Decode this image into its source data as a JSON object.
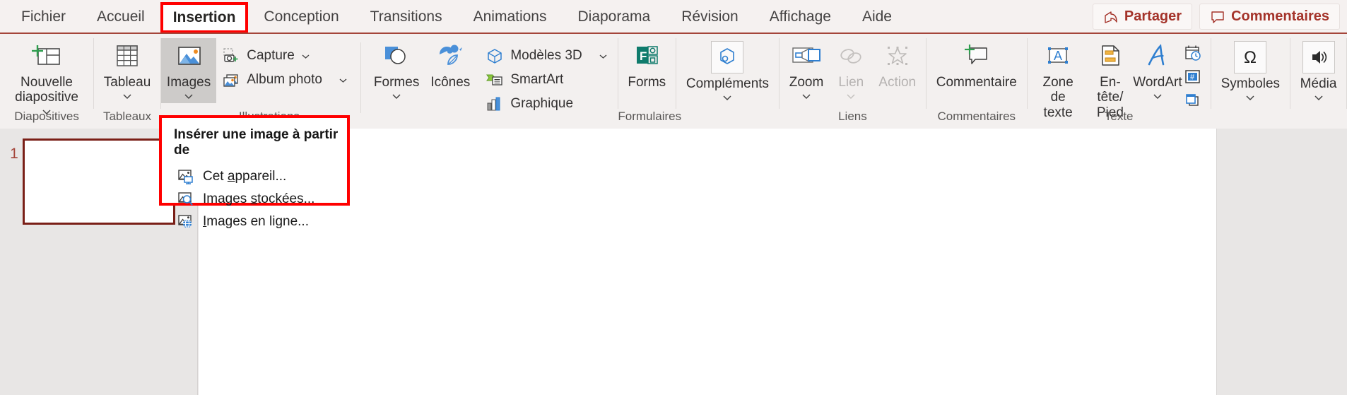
{
  "app": {
    "name": "PowerPoint",
    "language": "fr"
  },
  "tabbar": {
    "tabs": [
      {
        "id": "fichier",
        "label": "Fichier",
        "active": false
      },
      {
        "id": "accueil",
        "label": "Accueil",
        "active": false
      },
      {
        "id": "insertion",
        "label": "Insertion",
        "active": true
      },
      {
        "id": "conception",
        "label": "Conception",
        "active": false
      },
      {
        "id": "transitions",
        "label": "Transitions",
        "active": false
      },
      {
        "id": "animations",
        "label": "Animations",
        "active": false
      },
      {
        "id": "diaporama",
        "label": "Diaporama",
        "active": false
      },
      {
        "id": "revision",
        "label": "Révision",
        "active": false
      },
      {
        "id": "affichage",
        "label": "Affichage",
        "active": false
      },
      {
        "id": "aide",
        "label": "Aide",
        "active": false
      }
    ],
    "share_label": "Partager",
    "comments_label": "Commentaires",
    "accent_color": "#a4332a",
    "highlight_color": "#ff0000"
  },
  "ribbon": {
    "groups": [
      {
        "id": "diapositives",
        "label": "Diapositives",
        "buttons": [
          {
            "id": "nouvelle-diapositive",
            "label": "Nouvelle\ndiapositive",
            "icon": "new-slide-icon",
            "has_chevron": true
          }
        ]
      },
      {
        "id": "tableaux",
        "label": "Tableaux",
        "buttons": [
          {
            "id": "tableau",
            "label": "Tableau",
            "icon": "table-icon",
            "has_chevron": true
          }
        ]
      },
      {
        "id": "illustrations",
        "label": "Illustrations",
        "buttons": [
          {
            "id": "images",
            "label": "Images",
            "icon": "pictures-icon",
            "has_chevron": true,
            "selected": true
          },
          {
            "id": "formes",
            "label": "Formes",
            "icon": "shapes-icon",
            "has_chevron": true
          },
          {
            "id": "icones",
            "label": "Icônes",
            "icon": "icons-icon",
            "has_chevron": false
          }
        ],
        "small_buttons_1": [
          {
            "id": "capture",
            "label": "Capture",
            "icon": "screenshot-icon",
            "has_chevron": true
          },
          {
            "id": "album-photo",
            "label": "Album photo",
            "icon": "photo-album-icon",
            "has_chevron": true
          }
        ],
        "small_buttons_2": [
          {
            "id": "modeles-3d",
            "label": "Modèles 3D",
            "icon": "3d-model-icon",
            "has_chevron": true
          },
          {
            "id": "smartart",
            "label": "SmartArt",
            "icon": "smartart-icon",
            "has_chevron": false
          },
          {
            "id": "graphique",
            "label": "Graphique",
            "icon": "chart-icon",
            "has_chevron": false
          }
        ]
      },
      {
        "id": "formulaires",
        "label": "Formulaires",
        "buttons": [
          {
            "id": "forms",
            "label": "Forms",
            "icon": "forms-icon",
            "has_chevron": false
          }
        ]
      },
      {
        "id": "complements-group",
        "label": "",
        "buttons": [
          {
            "id": "complements",
            "label": "Compléments",
            "icon": "addins-icon",
            "has_chevron": true,
            "boxed": true
          }
        ]
      },
      {
        "id": "liens",
        "label": "Liens",
        "buttons": [
          {
            "id": "zoom",
            "label": "Zoom",
            "icon": "zoom-icon",
            "has_chevron": true
          },
          {
            "id": "lien",
            "label": "Lien",
            "icon": "link-icon",
            "has_chevron": true,
            "disabled": true
          },
          {
            "id": "action",
            "label": "Action",
            "icon": "action-icon",
            "has_chevron": false,
            "disabled": true
          }
        ]
      },
      {
        "id": "commentaires",
        "label": "Commentaires",
        "buttons": [
          {
            "id": "commentaire",
            "label": "Commentaire",
            "icon": "new-comment-icon",
            "has_chevron": false
          }
        ]
      },
      {
        "id": "texte",
        "label": "Texte",
        "buttons": [
          {
            "id": "zone-de-texte",
            "label": "Zone\nde texte",
            "icon": "text-box-icon",
            "has_chevron": false
          },
          {
            "id": "en-tete-pied",
            "label": "En-tête/\nPied",
            "icon": "header-footer-icon",
            "has_chevron": false
          },
          {
            "id": "wordart",
            "label": "WordArt",
            "icon": "wordart-icon",
            "has_chevron": true
          }
        ],
        "stack_buttons": [
          {
            "id": "date-heure",
            "label": "",
            "icon": "date-time-icon"
          },
          {
            "id": "numero-diapositive",
            "label": "",
            "icon": "slide-number-icon"
          },
          {
            "id": "objet",
            "label": "",
            "icon": "object-icon"
          }
        ]
      },
      {
        "id": "symboles-group",
        "label": "",
        "buttons": [
          {
            "id": "symboles",
            "label": "Symboles",
            "icon": "omega-icon",
            "has_chevron": true,
            "boxed": true
          }
        ]
      },
      {
        "id": "media-group",
        "label": "",
        "buttons": [
          {
            "id": "media",
            "label": "Média",
            "icon": "media-icon",
            "has_chevron": true,
            "boxed": true
          }
        ]
      }
    ],
    "collapse_icon": "chevron-up-icon"
  },
  "dropdown": {
    "title": "Insérer une image à partir de",
    "items": [
      {
        "id": "cet-appareil",
        "label_before": "Cet ",
        "accel": "a",
        "label_after": "ppareil...",
        "icon": "picture-device-icon"
      },
      {
        "id": "images-stockees",
        "label_before": "Images ",
        "accel": "s",
        "label_after": "tockées...",
        "icon": "picture-stock-icon"
      },
      {
        "id": "images-en-ligne",
        "label_before": "",
        "accel": "I",
        "label_after": "mages en ligne...",
        "icon": "picture-online-icon"
      }
    ],
    "border_color": "#ff0000"
  },
  "slides_pane": {
    "slides": [
      {
        "number": "1",
        "selected": true
      }
    ]
  }
}
